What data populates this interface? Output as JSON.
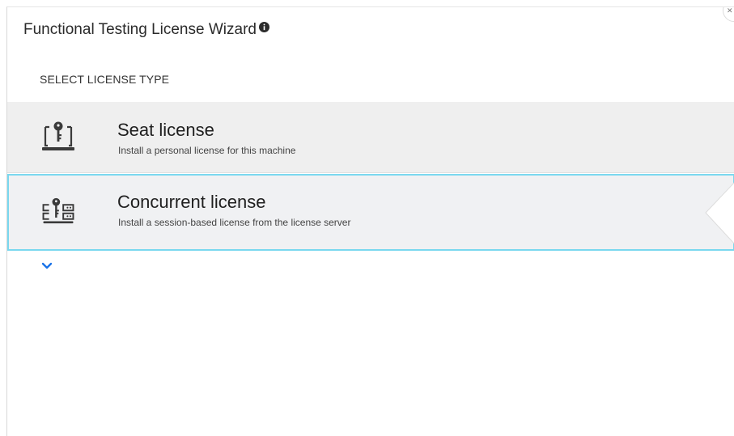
{
  "wizard": {
    "title": "Functional Testing License Wizard",
    "info_icon": "info-circle-icon",
    "close_icon": "close-icon"
  },
  "section": {
    "label": "SELECT LICENSE TYPE"
  },
  "options": [
    {
      "id": "seat",
      "icon": "laptop-key-icon",
      "title": "Seat license",
      "description": "Install a personal license for this machine",
      "selected": false
    },
    {
      "id": "concurrent",
      "icon": "server-key-icon",
      "title": "Concurrent license",
      "description": "Install a session-based license from the license server",
      "selected": true
    }
  ],
  "expand": {
    "icon": "chevron-down-icon"
  },
  "colors": {
    "selection_border": "#7ad8ef",
    "option_background": "#efefef",
    "chevron": "#1a73e8",
    "icon": "#3a3a3a"
  }
}
